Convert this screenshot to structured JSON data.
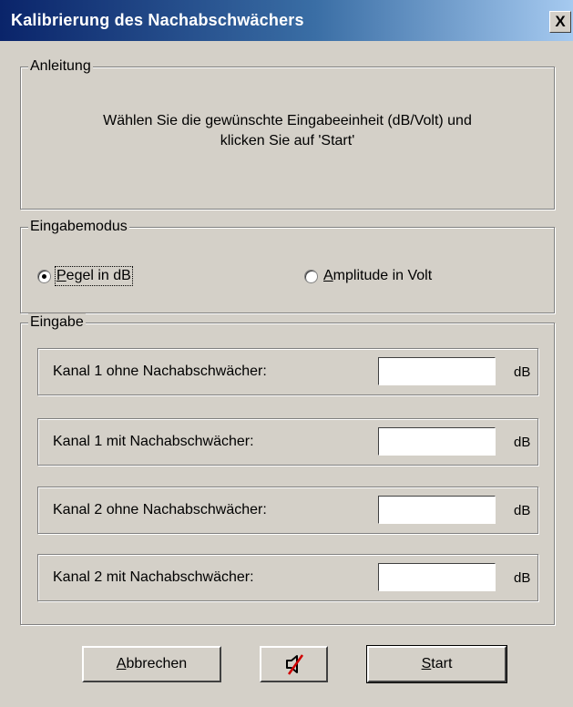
{
  "window": {
    "title": "Kalibrierung des Nachabschwächers",
    "close_glyph": "X"
  },
  "anleitung": {
    "legend": "Anleitung",
    "line1": "Wählen Sie die gewünschte Eingabeeinheit (dB/Volt) und",
    "line2": "klicken Sie auf 'Start'"
  },
  "eingabemodus": {
    "legend": "Eingabemodus",
    "options": [
      {
        "accel": "P",
        "rest": "egel in dB",
        "selected": true
      },
      {
        "accel": "A",
        "rest": "mplitude in Volt",
        "selected": false
      }
    ]
  },
  "eingabe": {
    "legend": "Eingabe",
    "rows": [
      {
        "label": "Kanal 1 ohne Nachabschwächer:",
        "value": "",
        "unit": "dB"
      },
      {
        "label": "Kanal 1 mit Nachabschwächer:",
        "value": "",
        "unit": "dB"
      },
      {
        "label": "Kanal 2 ohne Nachabschwächer:",
        "value": "",
        "unit": "dB"
      },
      {
        "label": "Kanal 2 mit Nachabschwächer:",
        "value": "",
        "unit": "dB"
      }
    ]
  },
  "buttons": {
    "cancel": {
      "accel": "A",
      "rest": "bbrechen"
    },
    "mute": {
      "icon": "speaker-muted-icon"
    },
    "start": {
      "accel": "S",
      "rest": "tart"
    }
  },
  "colors": {
    "face": "#d4d0c8",
    "title_start": "#0a246a",
    "title_end": "#a6caf0",
    "mute_slash": "#d00000"
  }
}
